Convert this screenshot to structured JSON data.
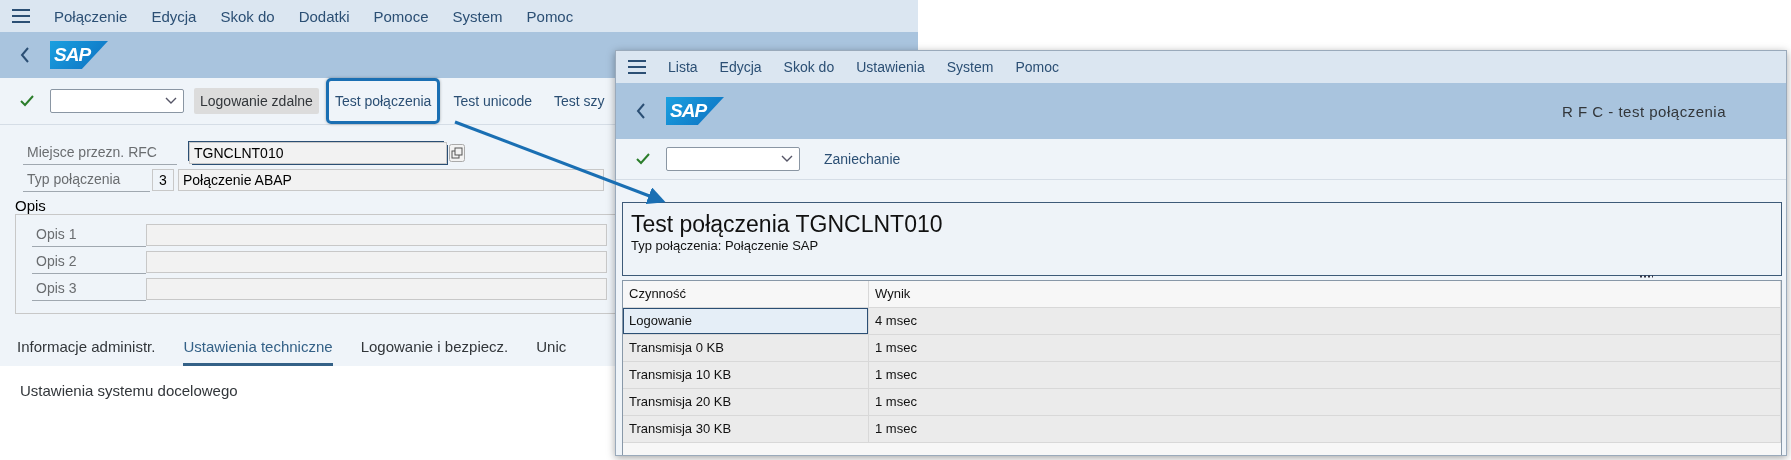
{
  "back_window": {
    "menu": [
      "Połączenie",
      "Edycja",
      "Skok do",
      "Dodatki",
      "Pomoce",
      "System",
      "Pomoc"
    ],
    "logo_text": "SAP",
    "toolbar": {
      "buttons": [
        {
          "label": "Logowanie zdalne",
          "kind": "emphasized",
          "callout": false
        },
        {
          "label": "Test połączenia",
          "kind": "plain",
          "callout": true
        },
        {
          "label": "Test unicode",
          "kind": "plain",
          "callout": false
        },
        {
          "label": "Test szy",
          "kind": "plain",
          "callout": false
        }
      ]
    },
    "fields": [
      {
        "label": "Miejsce przezn. RFC",
        "value": "TGNCLNT010",
        "focused": true
      },
      {
        "label": "Typ połączenia",
        "code": "3",
        "value": "Połączenie ABAP",
        "focused": false
      }
    ],
    "description_group": {
      "title": "Opis",
      "fields": [
        "Opis 1",
        "Opis 2",
        "Opis 3"
      ]
    },
    "tabs": [
      {
        "label": "Informacje administr.",
        "selected": false
      },
      {
        "label": "Ustawienia techniczne",
        "selected": true
      },
      {
        "label": "Logowanie i bezpiecz.",
        "selected": false
      },
      {
        "label": "Unic",
        "selected": false
      }
    ],
    "tab_content_heading": "Ustawienia systemu docelowego"
  },
  "front_window": {
    "menu": [
      "Lista",
      "Edycja",
      "Skok do",
      "Ustawienia",
      "System",
      "Pomoc"
    ],
    "logo_text": "SAP",
    "title": "R F C - test połączenia",
    "toolbar": {
      "buttons": [
        "Zaniechanie"
      ]
    },
    "heading": "Test połączenia TGNCLNT010",
    "subheading": "Typ połączenia: Połączenie SAP",
    "table": {
      "columns": [
        "Czynność",
        "Wynik"
      ],
      "rows": [
        {
          "cells": [
            "Logowanie",
            "4 msec"
          ],
          "selected": true
        },
        {
          "cells": [
            "Transmisja 0 KB",
            "1 msec"
          ],
          "selected": false
        },
        {
          "cells": [
            "Transmisja 10 KB",
            "1 msec"
          ],
          "selected": false
        },
        {
          "cells": [
            "Transmisja 20 KB",
            "1 msec"
          ],
          "selected": false
        },
        {
          "cells": [
            "Transmisja 30 KB",
            "1 msec"
          ],
          "selected": false
        }
      ]
    }
  }
}
